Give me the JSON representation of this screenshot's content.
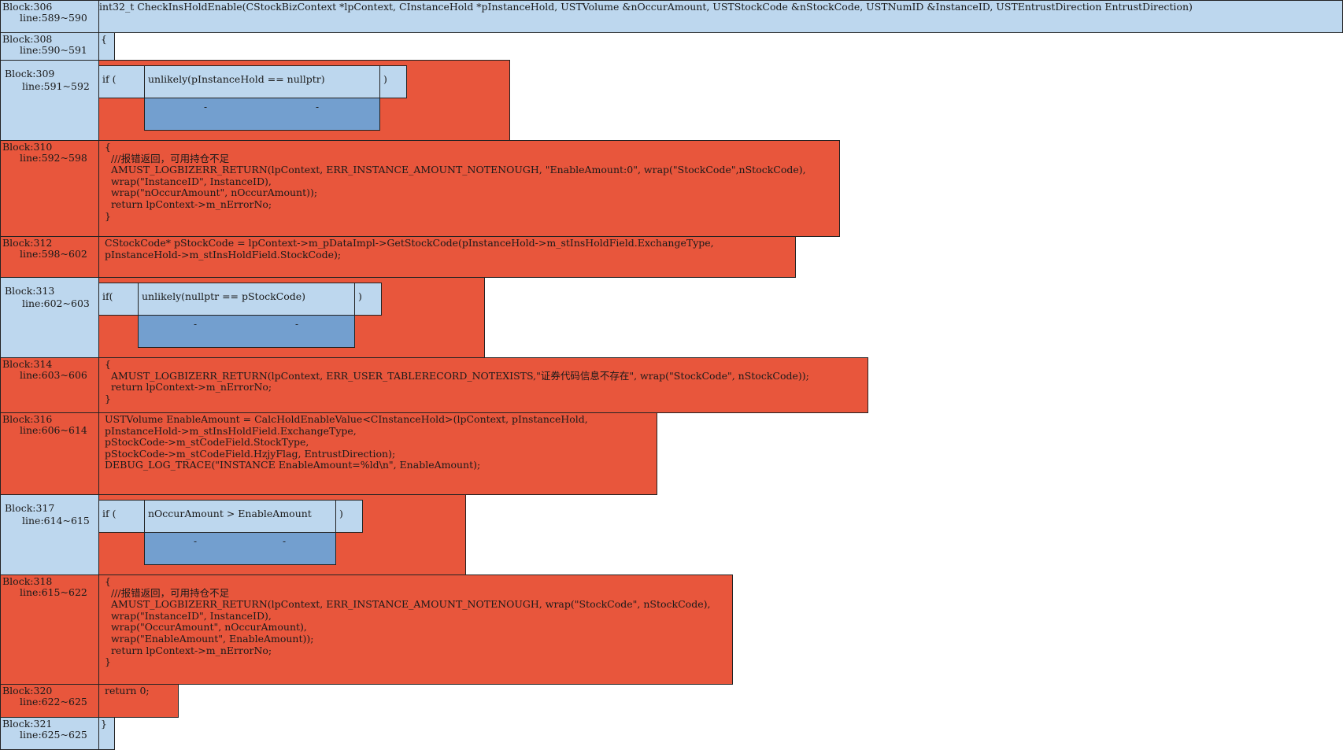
{
  "colors": {
    "block_label_light": "#bdd7ee",
    "block_label_red": "#e8563c",
    "code_red": "#e8563c",
    "code_light": "#bdd7ee",
    "branch_blue": "#739fcf"
  },
  "blocks": {
    "b306": {
      "name": "Block:306",
      "lines": "line:589~590",
      "code": "int32_t CheckInsHoldEnable(CStockBizContext *lpContext, CInstanceHold *pInstanceHold, USTVolume &nOccurAmount, USTStockCode &nStockCode, USTNumID &InstanceID, USTEntrustDirection EntrustDirection)"
    },
    "b308": {
      "name": "Block:308",
      "lines": "line:590~591",
      "code": "{"
    },
    "b309": {
      "name": "Block:309",
      "lines": "line:591~592",
      "keyword": "if (",
      "condition": "unlikely(pInstanceHold == nullptr)",
      "close": ")",
      "dash1": "-",
      "dash2": "-"
    },
    "b310": {
      "name": "Block:310",
      "lines": "line:592~598",
      "code": "{\n  ///报错返回，可用持仓不足\n  AMUST_LOGBIZERR_RETURN(lpContext, ERR_INSTANCE_AMOUNT_NOTENOUGH, \"EnableAmount:0\", wrap(\"StockCode\",nStockCode),\n  wrap(\"InstanceID\", InstanceID),\n  wrap(\"nOccurAmount\", nOccurAmount));\n  return lpContext->m_nErrorNo;\n}"
    },
    "b312": {
      "name": "Block:312",
      "lines": "line:598~602",
      "code": "CStockCode* pStockCode = lpContext->m_pDataImpl->GetStockCode(pInstanceHold->m_stInsHoldField.ExchangeType,\npInstanceHold->m_stInsHoldField.StockCode);"
    },
    "b313": {
      "name": "Block:313",
      "lines": "line:602~603",
      "keyword": "if(",
      "condition": "unlikely(nullptr == pStockCode)",
      "close": ")",
      "dash1": "-",
      "dash2": "-"
    },
    "b314": {
      "name": "Block:314",
      "lines": "line:603~606",
      "code": "{\n  AMUST_LOGBIZERR_RETURN(lpContext, ERR_USER_TABLERECORD_NOTEXISTS,\"证券代码信息不存在\", wrap(\"StockCode\", nStockCode));\n  return lpContext->m_nErrorNo;\n}"
    },
    "b316": {
      "name": "Block:316",
      "lines": "line:606~614",
      "code": "USTVolume EnableAmount = CalcHoldEnableValue<CInstanceHold>(lpContext, pInstanceHold,\npInstanceHold->m_stInsHoldField.ExchangeType,\npStockCode->m_stCodeField.StockType,\npStockCode->m_stCodeField.HzjyFlag, EntrustDirection);\nDEBUG_LOG_TRACE(\"INSTANCE EnableAmount=%ld\\n\", EnableAmount);"
    },
    "b317": {
      "name": "Block:317",
      "lines": "line:614~615",
      "keyword": "if (",
      "condition": "nOccurAmount > EnableAmount",
      "close": ")",
      "dash1": "-",
      "dash2": "-"
    },
    "b318": {
      "name": "Block:318",
      "lines": "line:615~622",
      "code": "{\n  ///报错返回，可用持仓不足\n  AMUST_LOGBIZERR_RETURN(lpContext, ERR_INSTANCE_AMOUNT_NOTENOUGH, wrap(\"StockCode\", nStockCode),\n  wrap(\"InstanceID\", InstanceID),\n  wrap(\"OccurAmount\", nOccurAmount),\n  wrap(\"EnableAmount\", EnableAmount));\n  return lpContext->m_nErrorNo;\n}"
    },
    "b320": {
      "name": "Block:320",
      "lines": "line:622~625",
      "code": "return 0;"
    },
    "b321": {
      "name": "Block:321",
      "lines": "line:625~625",
      "code": "}"
    }
  }
}
